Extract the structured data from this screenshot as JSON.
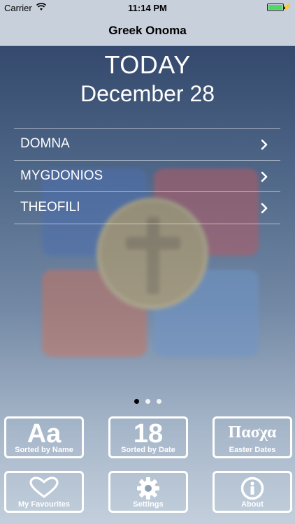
{
  "status_bar": {
    "carrier": "Carrier",
    "time": "11:14 PM",
    "battery_level": 1.0,
    "battery_color": "#4cd964"
  },
  "nav": {
    "title": "Greek Onoma"
  },
  "main": {
    "today_label": "TODAY",
    "date_label": "December 28",
    "names": [
      {
        "label": "DOMNA",
        "icon": "chevron-right-icon"
      },
      {
        "label": "MYGDONIOS",
        "icon": "chevron-right-icon"
      },
      {
        "label": "THEOFILI",
        "icon": "chevron-right-icon"
      }
    ],
    "page_indicator": {
      "count": 3,
      "active_index": 0
    }
  },
  "tiles": {
    "sorted_by_name": {
      "big": "Aa",
      "label": "Sorted by Name"
    },
    "sorted_by_date": {
      "big": "18",
      "label": "Sorted by Date"
    },
    "easter_dates": {
      "big": "Πασχα",
      "label": "Easter Dates"
    },
    "favourites": {
      "icon": "heart-icon",
      "label": "My Favourites"
    },
    "settings": {
      "icon": "gear-icon",
      "label": "Settings"
    },
    "about": {
      "icon": "info-icon",
      "label": "About"
    }
  }
}
